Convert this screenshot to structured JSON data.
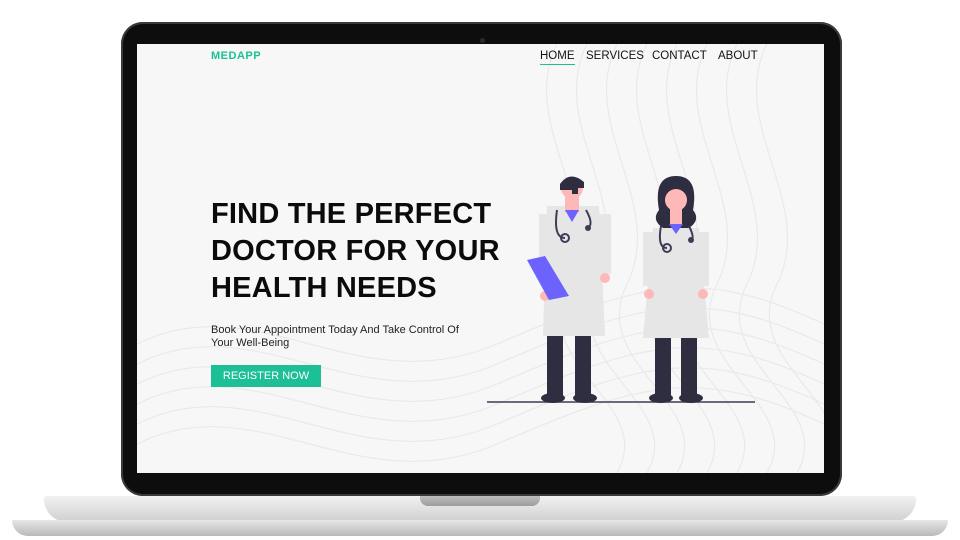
{
  "header": {
    "logo": "MEDAPP"
  },
  "nav": {
    "items": [
      "HOME",
      "SERVICES",
      "CONTACT",
      "ABOUT"
    ],
    "active": "HOME"
  },
  "hero": {
    "headline_lines": [
      "FIND THE PERFECT",
      "DOCTOR FOR YOUR",
      "HEALTH NEEDS"
    ],
    "subtext_lines": [
      "Book Your Appointment Today And Take Control Of",
      "Your Well-Being"
    ],
    "cta_label": "REGISTER NOW"
  },
  "colors": {
    "accent": "#1cbf96",
    "clipboard": "#6c63ff"
  }
}
